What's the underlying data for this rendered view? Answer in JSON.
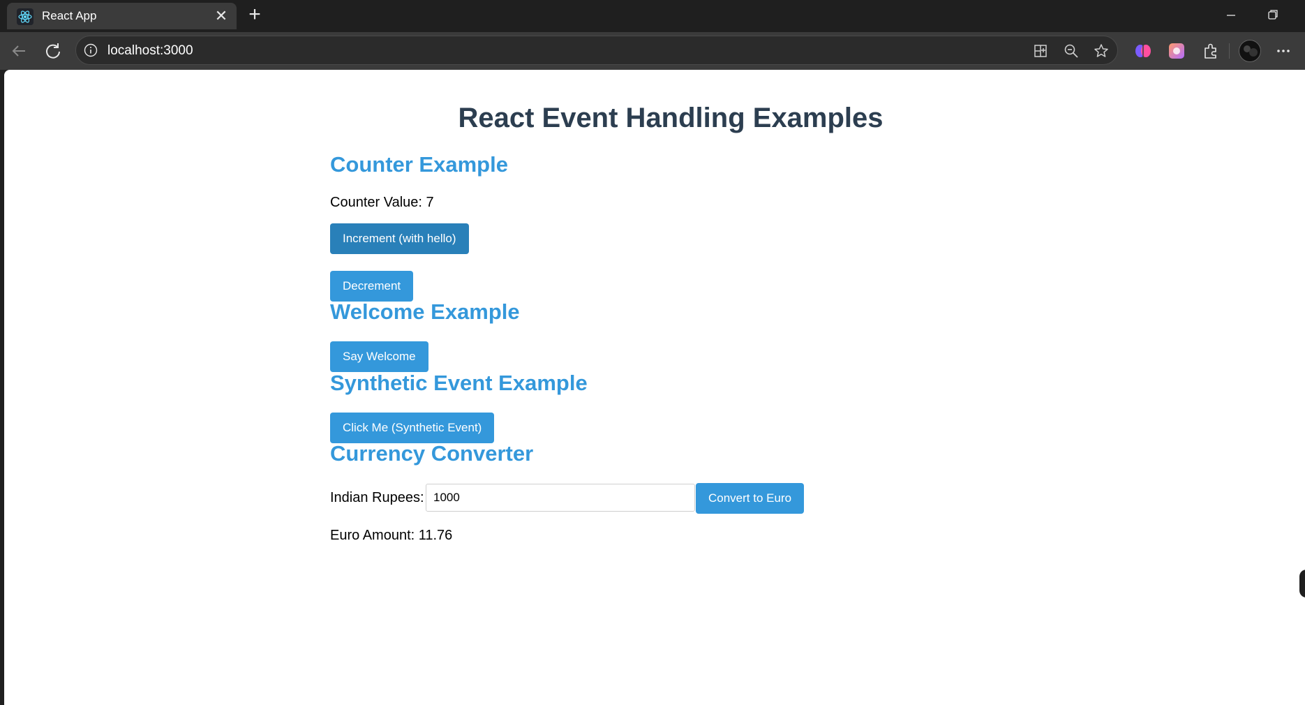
{
  "browser": {
    "tab_title": "React App",
    "url": "localhost:3000"
  },
  "page": {
    "title": "React Event Handling Examples",
    "counter": {
      "heading": "Counter Example",
      "value_text": "Counter Value: 7",
      "increment_label": "Increment (with hello)",
      "decrement_label": "Decrement"
    },
    "welcome": {
      "heading": "Welcome Example",
      "button_label": "Say Welcome"
    },
    "synthetic": {
      "heading": "Synthetic Event Example",
      "button_label": "Click Me (Synthetic Event)"
    },
    "currency": {
      "heading": "Currency Converter",
      "input_label": "Indian Rupees:",
      "input_value": "1000",
      "convert_label": "Convert to Euro",
      "result_text": "Euro Amount: 11.76"
    }
  },
  "colors": {
    "heading_blue": "#3498db",
    "title_dark": "#2c3e50",
    "button_blue": "#3498db",
    "button_active": "#2980b9"
  }
}
